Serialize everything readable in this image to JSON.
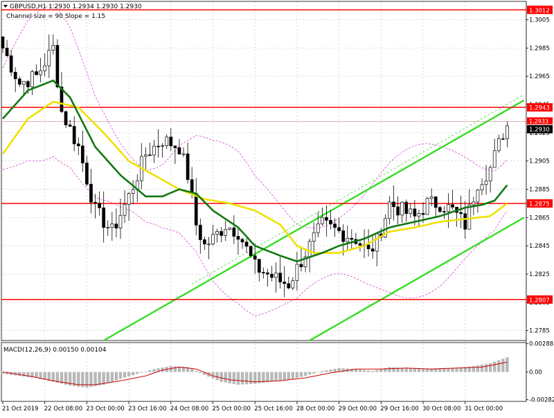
{
  "header": {
    "symbol_line": "GBPUSD,H1  1.2930 1.2934 1.2930 1.2930",
    "channel_line": "Channel size = 90  Slope = 1.15"
  },
  "colors": {
    "background": "#ffffff",
    "grid": "#c0c0c0",
    "candle": "#000000",
    "level_line": "#ff0000",
    "level_label_bg": "#ff0000",
    "price_label_bg": "#000000",
    "fast_ma": "#117711",
    "slow_ma": "#f0e000",
    "envelope": "#cc33cc",
    "channel": "#33dd22",
    "macd_signal": "#cc0000",
    "macd_hist": "#b8b8b8"
  },
  "price_axis": {
    "ticks": [
      "1.3005",
      "1.2985",
      "1.2965",
      "1.2945",
      "1.2925",
      "1.2905",
      "1.2885",
      "1.2865",
      "1.2845",
      "1.2825",
      "1.2805",
      "1.2785"
    ],
    "tick_values": [
      1.3005,
      1.2985,
      1.2965,
      1.2945,
      1.2925,
      1.2905,
      1.2885,
      1.2865,
      1.2845,
      1.2825,
      1.2805,
      1.2785
    ],
    "range": [
      1.2778,
      1.3018
    ]
  },
  "levels": [
    {
      "label": "1.3012",
      "value": 1.3012
    },
    {
      "label": "1.2943",
      "value": 1.2943
    },
    {
      "label": "1.2875",
      "value": 1.2875
    },
    {
      "label": "1.2807",
      "value": 1.2807
    }
  ],
  "current_price": {
    "label": "1.2930",
    "value": 1.293,
    "shadow_label": "1.2933",
    "shadow_value": 1.2933
  },
  "time_axis": {
    "labels": [
      "21 Oct 2019",
      "22 Oct 08:00",
      "23 Oct 00:00",
      "23 Oct 16:00",
      "24 Oct 08:00",
      "25 Oct 00:00",
      "25 Oct 16:00",
      "28 Oct 00:00",
      "29 Oct 00:00",
      "29 Oct 16:00",
      "30 Oct 08:00",
      "31 Oct 00:00"
    ],
    "label_index": [
      0,
      10,
      20,
      30,
      40,
      50,
      60,
      70,
      80,
      90,
      100,
      110
    ]
  },
  "macd": {
    "title": "MACD(12,26,9) 0.00150 0.00104",
    "ticks": [
      "0.00288",
      "0.00",
      "-0.00282"
    ],
    "tick_values": [
      0.00288,
      0.0,
      -0.00282
    ],
    "range": [
      -0.003,
      0.003
    ]
  },
  "chart_data": {
    "type": "candlestick",
    "symbol": "GBPUSD",
    "timeframe": "H1",
    "bars": 121,
    "close_anchors": [
      [
        0,
        1.2985
      ],
      [
        4,
        1.296
      ],
      [
        8,
        1.2965
      ],
      [
        12,
        1.2985
      ],
      [
        14,
        1.294
      ],
      [
        18,
        1.2915
      ],
      [
        22,
        1.287
      ],
      [
        26,
        1.2855
      ],
      [
        30,
        1.288
      ],
      [
        34,
        1.291
      ],
      [
        38,
        1.292
      ],
      [
        42,
        1.2915
      ],
      [
        44,
        1.2895
      ],
      [
        46,
        1.286
      ],
      [
        48,
        1.2845
      ],
      [
        50,
        1.285
      ],
      [
        53,
        1.286
      ],
      [
        56,
        1.2855
      ],
      [
        60,
        1.283
      ],
      [
        63,
        1.2825
      ],
      [
        66,
        1.282
      ],
      [
        68,
        1.2818
      ],
      [
        72,
        1.284
      ],
      [
        76,
        1.286
      ],
      [
        80,
        1.2855
      ],
      [
        84,
        1.285
      ],
      [
        87,
        1.284
      ],
      [
        89,
        1.2848
      ],
      [
        92,
        1.2875
      ],
      [
        95,
        1.287
      ],
      [
        98,
        1.2865
      ],
      [
        101,
        1.2875
      ],
      [
        104,
        1.2875
      ],
      [
        107,
        1.287
      ],
      [
        110,
        1.286
      ],
      [
        113,
        1.289
      ],
      [
        116,
        1.29
      ],
      [
        119,
        1.2925
      ],
      [
        120,
        1.293
      ]
    ],
    "fast_ma_anchors": [
      [
        0,
        1.2935
      ],
      [
        6,
        1.2955
      ],
      [
        12,
        1.2962
      ],
      [
        16,
        1.295
      ],
      [
        22,
        1.2915
      ],
      [
        28,
        1.2895
      ],
      [
        34,
        1.288
      ],
      [
        38,
        1.288
      ],
      [
        42,
        1.2885
      ],
      [
        46,
        1.2882
      ],
      [
        50,
        1.287
      ],
      [
        56,
        1.2858
      ],
      [
        60,
        1.2845
      ],
      [
        66,
        1.2838
      ],
      [
        70,
        1.2834
      ],
      [
        76,
        1.284
      ],
      [
        80,
        1.2845
      ],
      [
        86,
        1.285
      ],
      [
        92,
        1.2858
      ],
      [
        98,
        1.2862
      ],
      [
        104,
        1.2866
      ],
      [
        110,
        1.2872
      ],
      [
        114,
        1.2874
      ],
      [
        117,
        1.2877
      ],
      [
        120,
        1.2888
      ]
    ],
    "slow_ma_anchors": [
      [
        0,
        1.291
      ],
      [
        6,
        1.2935
      ],
      [
        12,
        1.2947
      ],
      [
        18,
        1.2943
      ],
      [
        24,
        1.2925
      ],
      [
        30,
        1.2905
      ],
      [
        36,
        1.2895
      ],
      [
        42,
        1.2885
      ],
      [
        48,
        1.2878
      ],
      [
        54,
        1.2875
      ],
      [
        60,
        1.287
      ],
      [
        66,
        1.286
      ],
      [
        70,
        1.2845
      ],
      [
        74,
        1.284
      ],
      [
        80,
        1.284
      ],
      [
        86,
        1.2845
      ],
      [
        92,
        1.2855
      ],
      [
        98,
        1.2858
      ],
      [
        104,
        1.2862
      ],
      [
        110,
        1.2864
      ],
      [
        116,
        1.2866
      ],
      [
        120,
        1.2875
      ]
    ],
    "envelope_offset": 0.0045,
    "channel_lines": [
      {
        "from": [
          24,
          1.2778
        ],
        "to": [
          124,
          1.2948
        ]
      },
      {
        "from": [
          45,
          1.2818
        ],
        "to": [
          124,
          1.2952
        ]
      },
      {
        "from": [
          73,
          1.2778
        ],
        "to": [
          124,
          1.2865
        ]
      }
    ],
    "macd_hist_anchors": [
      [
        0,
        -0.0002
      ],
      [
        4,
        -0.0004
      ],
      [
        8,
        -0.0006
      ],
      [
        12,
        -0.001
      ],
      [
        16,
        -0.0014
      ],
      [
        20,
        -0.0016
      ],
      [
        24,
        -0.0013
      ],
      [
        28,
        -0.0007
      ],
      [
        32,
        -0.0002
      ],
      [
        36,
        0.0003
      ],
      [
        40,
        0.0006
      ],
      [
        44,
        0.0005
      ],
      [
        48,
        -0.0003
      ],
      [
        52,
        -0.001
      ],
      [
        56,
        -0.0013
      ],
      [
        60,
        -0.0012
      ],
      [
        64,
        -0.001
      ],
      [
        68,
        -0.0008
      ],
      [
        72,
        -0.0004
      ],
      [
        76,
        0.0001
      ],
      [
        80,
        0.0004
      ],
      [
        84,
        0.0003
      ],
      [
        88,
        0.0001
      ],
      [
        92,
        0.0005
      ],
      [
        96,
        0.0004
      ],
      [
        100,
        0.0003
      ],
      [
        104,
        0.0004
      ],
      [
        108,
        0.0004
      ],
      [
        112,
        0.0006
      ],
      [
        116,
        0.0009
      ],
      [
        120,
        0.0015
      ]
    ],
    "macd_signal_anchors": [
      [
        0,
        0.0
      ],
      [
        6,
        -0.0004
      ],
      [
        12,
        -0.0009
      ],
      [
        18,
        -0.0013
      ],
      [
        22,
        -0.0013
      ],
      [
        28,
        -0.0009
      ],
      [
        34,
        -0.0004
      ],
      [
        38,
        0.0002
      ],
      [
        42,
        0.0005
      ],
      [
        46,
        0.0003
      ],
      [
        50,
        -0.0004
      ],
      [
        54,
        -0.0008
      ],
      [
        60,
        -0.001
      ],
      [
        66,
        -0.0009
      ],
      [
        72,
        -0.0006
      ],
      [
        78,
        -0.0001
      ],
      [
        84,
        0.0003
      ],
      [
        90,
        0.0003
      ],
      [
        96,
        0.0004
      ],
      [
        102,
        0.0003
      ],
      [
        108,
        0.0004
      ],
      [
        114,
        0.0005
      ],
      [
        120,
        0.001
      ]
    ]
  }
}
